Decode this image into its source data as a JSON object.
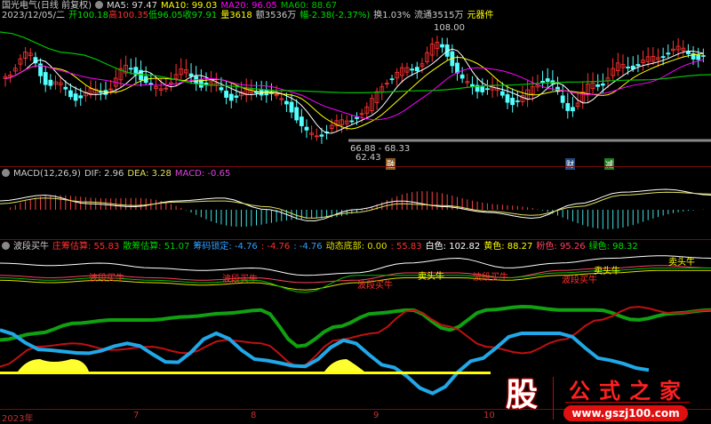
{
  "header": {
    "title": "国光电气(日线 前复权)",
    "ma5": "MA5: 97.47",
    "ma10": "MA10: 99.03",
    "ma20": "MA20: 96.05",
    "ma60": "MA60: 88.67",
    "date": "2023/12/05/二",
    "open": "开100.18",
    "high": "高100.35",
    "low": "低96.05",
    "close": "收97.91",
    "vol": "量3618",
    "amount": "额3536万",
    "change": "幅-2.38(-2.37%)",
    "turnover": "换1.03%",
    "float": "流通3515万",
    "sector": "元器件"
  },
  "main": {
    "high_mark": "108.00",
    "range_mark": "66.88 - 68.33",
    "low_mark": "62.43",
    "tags": [
      "融",
      "财",
      "减"
    ]
  },
  "macd": {
    "title": "MACD(12,26,9)",
    "dif": "DIF: 2.96",
    "dea": "DEA: 3.28",
    "macd": "MACD: -0.65"
  },
  "indicator": {
    "title": "波段买牛",
    "z1": "庄筹估算: 55.83",
    "z2": "散筹估算: 51.07",
    "z3": "筹码锁定: -4.76",
    "z4": ": -4.76",
    "z5": ": -4.76",
    "z6": "动态底部: 0.00",
    "z7": ": 55.83",
    "z8": "白色: 102.82",
    "z9": "黄色: 88.27",
    "z10": "粉色: 95.26",
    "z11": "绿色: 98.32",
    "buy_labels": [
      "波段买牛",
      "波段买牛",
      "波段买牛",
      "波段买牛",
      "波段买牛"
    ],
    "sell_labels": [
      "卖头牛",
      "卖头牛",
      "卖头牛"
    ]
  },
  "axis": {
    "labels": [
      "2023年",
      "7",
      "8",
      "9",
      "10"
    ]
  },
  "watermark": {
    "char": "股",
    "name": "公式之家",
    "url": "www.gszj100.com"
  },
  "colors": {
    "up": "#ff3232",
    "down": "#54ffff",
    "ma5": "#ffffff",
    "ma10": "#ffff00",
    "ma20": "#ff00ff",
    "ma60": "#00c000"
  }
}
